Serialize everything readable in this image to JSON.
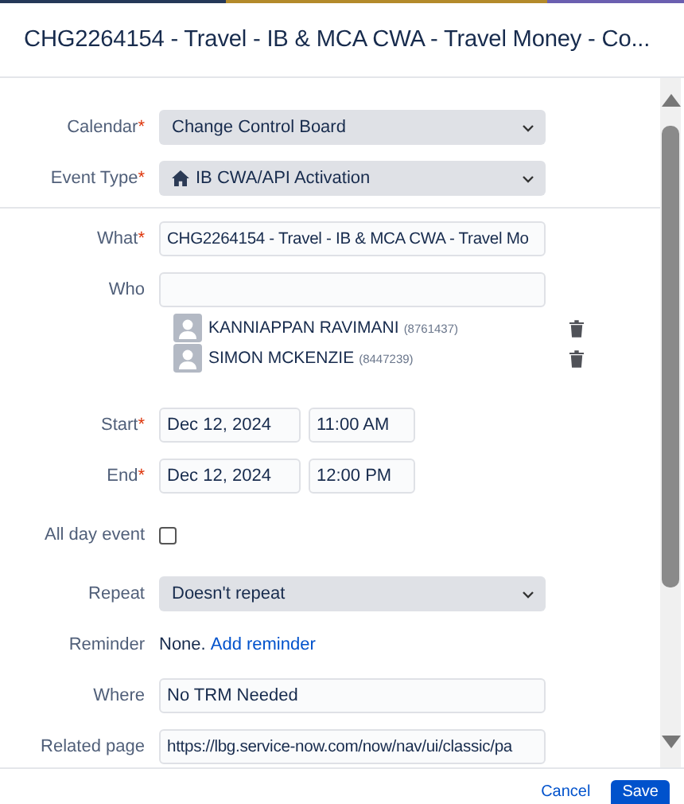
{
  "dialog": {
    "title": "CHG2264154 - Travel - IB & MCA CWA - Travel Money - Co..."
  },
  "form": {
    "calendar": {
      "label": "Calendar",
      "required": "*",
      "value": "Change Control Board"
    },
    "event_type": {
      "label": "Event Type",
      "required": "*",
      "value": "IB CWA/API Activation"
    },
    "what": {
      "label": "What",
      "required": "*",
      "value": "CHG2264154 - Travel - IB & MCA CWA - Travel Mo"
    },
    "who": {
      "label": "Who",
      "people": [
        {
          "name": "KANNIAPPAN RAVIMANI",
          "id": "(8761437)"
        },
        {
          "name": "SIMON MCKENZIE",
          "id": "(8447239)"
        }
      ]
    },
    "start": {
      "label": "Start",
      "required": "*",
      "date": "Dec 12, 2024",
      "time": "11:00 AM"
    },
    "end": {
      "label": "End",
      "required": "*",
      "date": "Dec 12, 2024",
      "time": "12:00 PM"
    },
    "all_day": {
      "label": "All day event",
      "checked": false
    },
    "repeat": {
      "label": "Repeat",
      "value": "Doesn't repeat"
    },
    "reminder": {
      "label": "Reminder",
      "text": "None.",
      "link": "Add reminder"
    },
    "where": {
      "label": "Where",
      "value": "No TRM Needed"
    },
    "related": {
      "label": "Related page",
      "value": "https://lbg.service-now.com/now/nav/ui/classic/pa"
    }
  },
  "buttons": {
    "cancel": "Cancel",
    "save": "Save"
  }
}
